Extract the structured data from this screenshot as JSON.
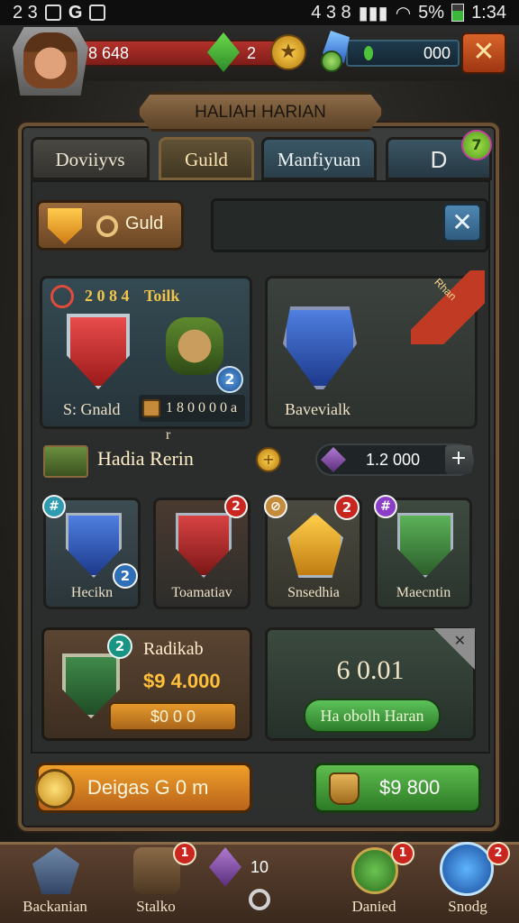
{
  "status_bar": {
    "left": "2 3",
    "carrier": "G",
    "right_numbers": "4 3 8",
    "battery_text": "5%",
    "time": "1:34"
  },
  "hud": {
    "hp_left": "8 648",
    "hp_right": "2",
    "gold_right": "000",
    "close_label": "✕"
  },
  "title": "HALIAH HARIAN",
  "tabs": [
    {
      "label": "Doviiyvs"
    },
    {
      "label": "Guild"
    },
    {
      "label": "Manfiyuan"
    },
    {
      "label": "D"
    }
  ],
  "tab_badge": "7",
  "guild_button": {
    "label": "Guld"
  },
  "search": {
    "placeholder": "",
    "close_label": "✕"
  },
  "card_left": {
    "number": "2 0 8 4",
    "name": "Toilk",
    "badge": "2",
    "foot_left": "S: Gnald",
    "foot_right": "1 8 0 0 0 0 a r"
  },
  "card_right": {
    "ribbon": "Rhan",
    "label": "Bavevialk"
  },
  "row": {
    "title": "Hadia Rerin",
    "coin_symbol": "+",
    "value": "1.2 000",
    "plus_label": "+"
  },
  "items": [
    {
      "label": "Hecikn",
      "badge": "#",
      "badge2": "2"
    },
    {
      "label": "Toamatiav",
      "badge": "2"
    },
    {
      "label": "Snsedhia",
      "badge": "⊘",
      "badge2": "2"
    },
    {
      "label": "Maecntin",
      "badge": "#"
    }
  ],
  "offer_left": {
    "badge": "2",
    "name": "Radikab",
    "price": "$9 4.000",
    "pill": "$0 0 0"
  },
  "offer_right": {
    "amount": "6 0.01",
    "button": "Ha obolh Haran",
    "corner": "✕"
  },
  "bottom_buttons": {
    "left": "Deigas G 0 m",
    "right": "$9 800"
  },
  "nav": [
    {
      "label": "Backanian",
      "badge": ""
    },
    {
      "label": "Stalko",
      "badge": "1"
    },
    {
      "label": "",
      "number": "10"
    },
    {
      "label": "Danied",
      "badge": "1"
    },
    {
      "label": "Snodg",
      "badge": "2"
    }
  ]
}
